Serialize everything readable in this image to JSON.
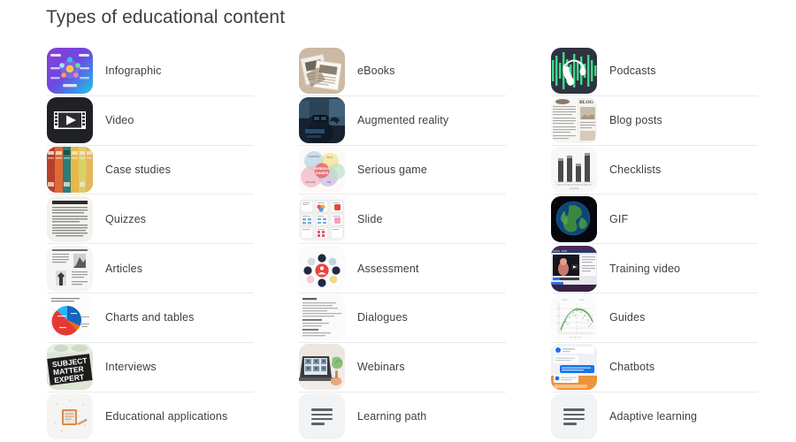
{
  "page": {
    "title": "Types of educational content",
    "background_color": "#ffffff",
    "text_color": "#3c4043",
    "divider_color": "#e8eaed",
    "placeholder_bg_color": "#f1f3f4"
  },
  "columns": [
    {
      "name": "column-1",
      "items": [
        {
          "label": "Infographic",
          "icon": "infographic-thumbnail"
        },
        {
          "label": "Video",
          "icon": "video-thumbnail"
        },
        {
          "label": "Case studies",
          "icon": "case-studies-thumbnail"
        },
        {
          "label": "Quizzes",
          "icon": "quizzes-thumbnail"
        },
        {
          "label": "Articles",
          "icon": "articles-thumbnail"
        },
        {
          "label": "Charts and tables",
          "icon": "charts-and-tables-thumbnail"
        },
        {
          "label": "Interviews",
          "icon": "interviews-thumbnail"
        },
        {
          "label": "Educational applications",
          "icon": "educational-applications-thumbnail"
        }
      ]
    },
    {
      "name": "column-2",
      "items": [
        {
          "label": "eBooks",
          "icon": "ebooks-thumbnail"
        },
        {
          "label": "Augmented reality",
          "icon": "augmented-reality-thumbnail"
        },
        {
          "label": "Serious game",
          "icon": "serious-game-thumbnail"
        },
        {
          "label": "Slide",
          "icon": "slide-thumbnail"
        },
        {
          "label": "Assessment",
          "icon": "assessment-thumbnail"
        },
        {
          "label": "Dialogues",
          "icon": "dialogues-thumbnail"
        },
        {
          "label": "Webinars",
          "icon": "webinars-thumbnail"
        },
        {
          "label": "Learning path",
          "icon": "placeholder-lines-icon"
        }
      ]
    },
    {
      "name": "column-3",
      "items": [
        {
          "label": "Podcasts",
          "icon": "podcasts-thumbnail"
        },
        {
          "label": "Blog posts",
          "icon": "blog-posts-thumbnail"
        },
        {
          "label": "Checklists",
          "icon": "checklists-thumbnail"
        },
        {
          "label": "GIF",
          "icon": "gif-thumbnail"
        },
        {
          "label": "Training video",
          "icon": "training-video-thumbnail"
        },
        {
          "label": "Guides",
          "icon": "guides-thumbnail"
        },
        {
          "label": "Chatbots",
          "icon": "chatbots-thumbnail"
        },
        {
          "label": "Adaptive learning",
          "icon": "placeholder-lines-icon"
        }
      ]
    }
  ]
}
